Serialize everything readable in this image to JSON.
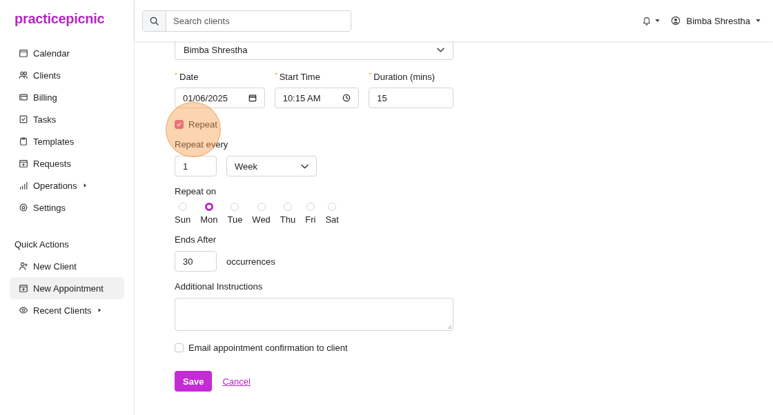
{
  "sidebar": {
    "logo": "practicepicnic",
    "nav": [
      {
        "label": "Calendar",
        "submenu": false,
        "selected": false
      },
      {
        "label": "Clients",
        "submenu": false,
        "selected": false
      },
      {
        "label": "Billing",
        "submenu": false,
        "selected": false
      },
      {
        "label": "Tasks",
        "submenu": false,
        "selected": false
      },
      {
        "label": "Templates",
        "submenu": false,
        "selected": false
      },
      {
        "label": "Requests",
        "submenu": false,
        "selected": false
      },
      {
        "label": "Operations",
        "submenu": true,
        "selected": false
      },
      {
        "label": "Settings",
        "submenu": false,
        "selected": false
      }
    ],
    "quick_actions_title": "Quick Actions",
    "quick_actions": [
      {
        "label": "New Client",
        "submenu": false,
        "selected": false
      },
      {
        "label": "New Appointment",
        "submenu": false,
        "selected": true
      },
      {
        "label": "Recent Clients",
        "submenu": true,
        "selected": false
      }
    ]
  },
  "header": {
    "search": {
      "placeholder": "Search clients"
    },
    "user": "Bimba Shrestha"
  },
  "form": {
    "client": "Bimba Shrestha",
    "date": {
      "label": "Date",
      "value": "01/06/2025"
    },
    "start_time": {
      "label": "Start Time",
      "value": "10:15  AM"
    },
    "duration": {
      "label": "Duration (mins)",
      "value": "15"
    },
    "repeat": {
      "label": "Repeat",
      "checked": true
    },
    "repeat_every": {
      "label": "Repeat every",
      "value": "1",
      "unit": "Week"
    },
    "repeat_on": {
      "label": "Repeat on",
      "days": [
        {
          "label": "Sun",
          "selected": false
        },
        {
          "label": "Mon",
          "selected": true
        },
        {
          "label": "Tue",
          "selected": false
        },
        {
          "label": "Wed",
          "selected": false
        },
        {
          "label": "Thu",
          "selected": false
        },
        {
          "label": "Fri",
          "selected": false
        },
        {
          "label": "Sat",
          "selected": false
        }
      ]
    },
    "ends_after": {
      "label": "Ends After",
      "value": "30",
      "suffix": "occurrences"
    },
    "instructions": {
      "label": "Additional Instructions"
    },
    "email": {
      "label": "Email appointment confirmation to client",
      "checked": false
    },
    "save": "Save",
    "cancel": "Cancel"
  }
}
